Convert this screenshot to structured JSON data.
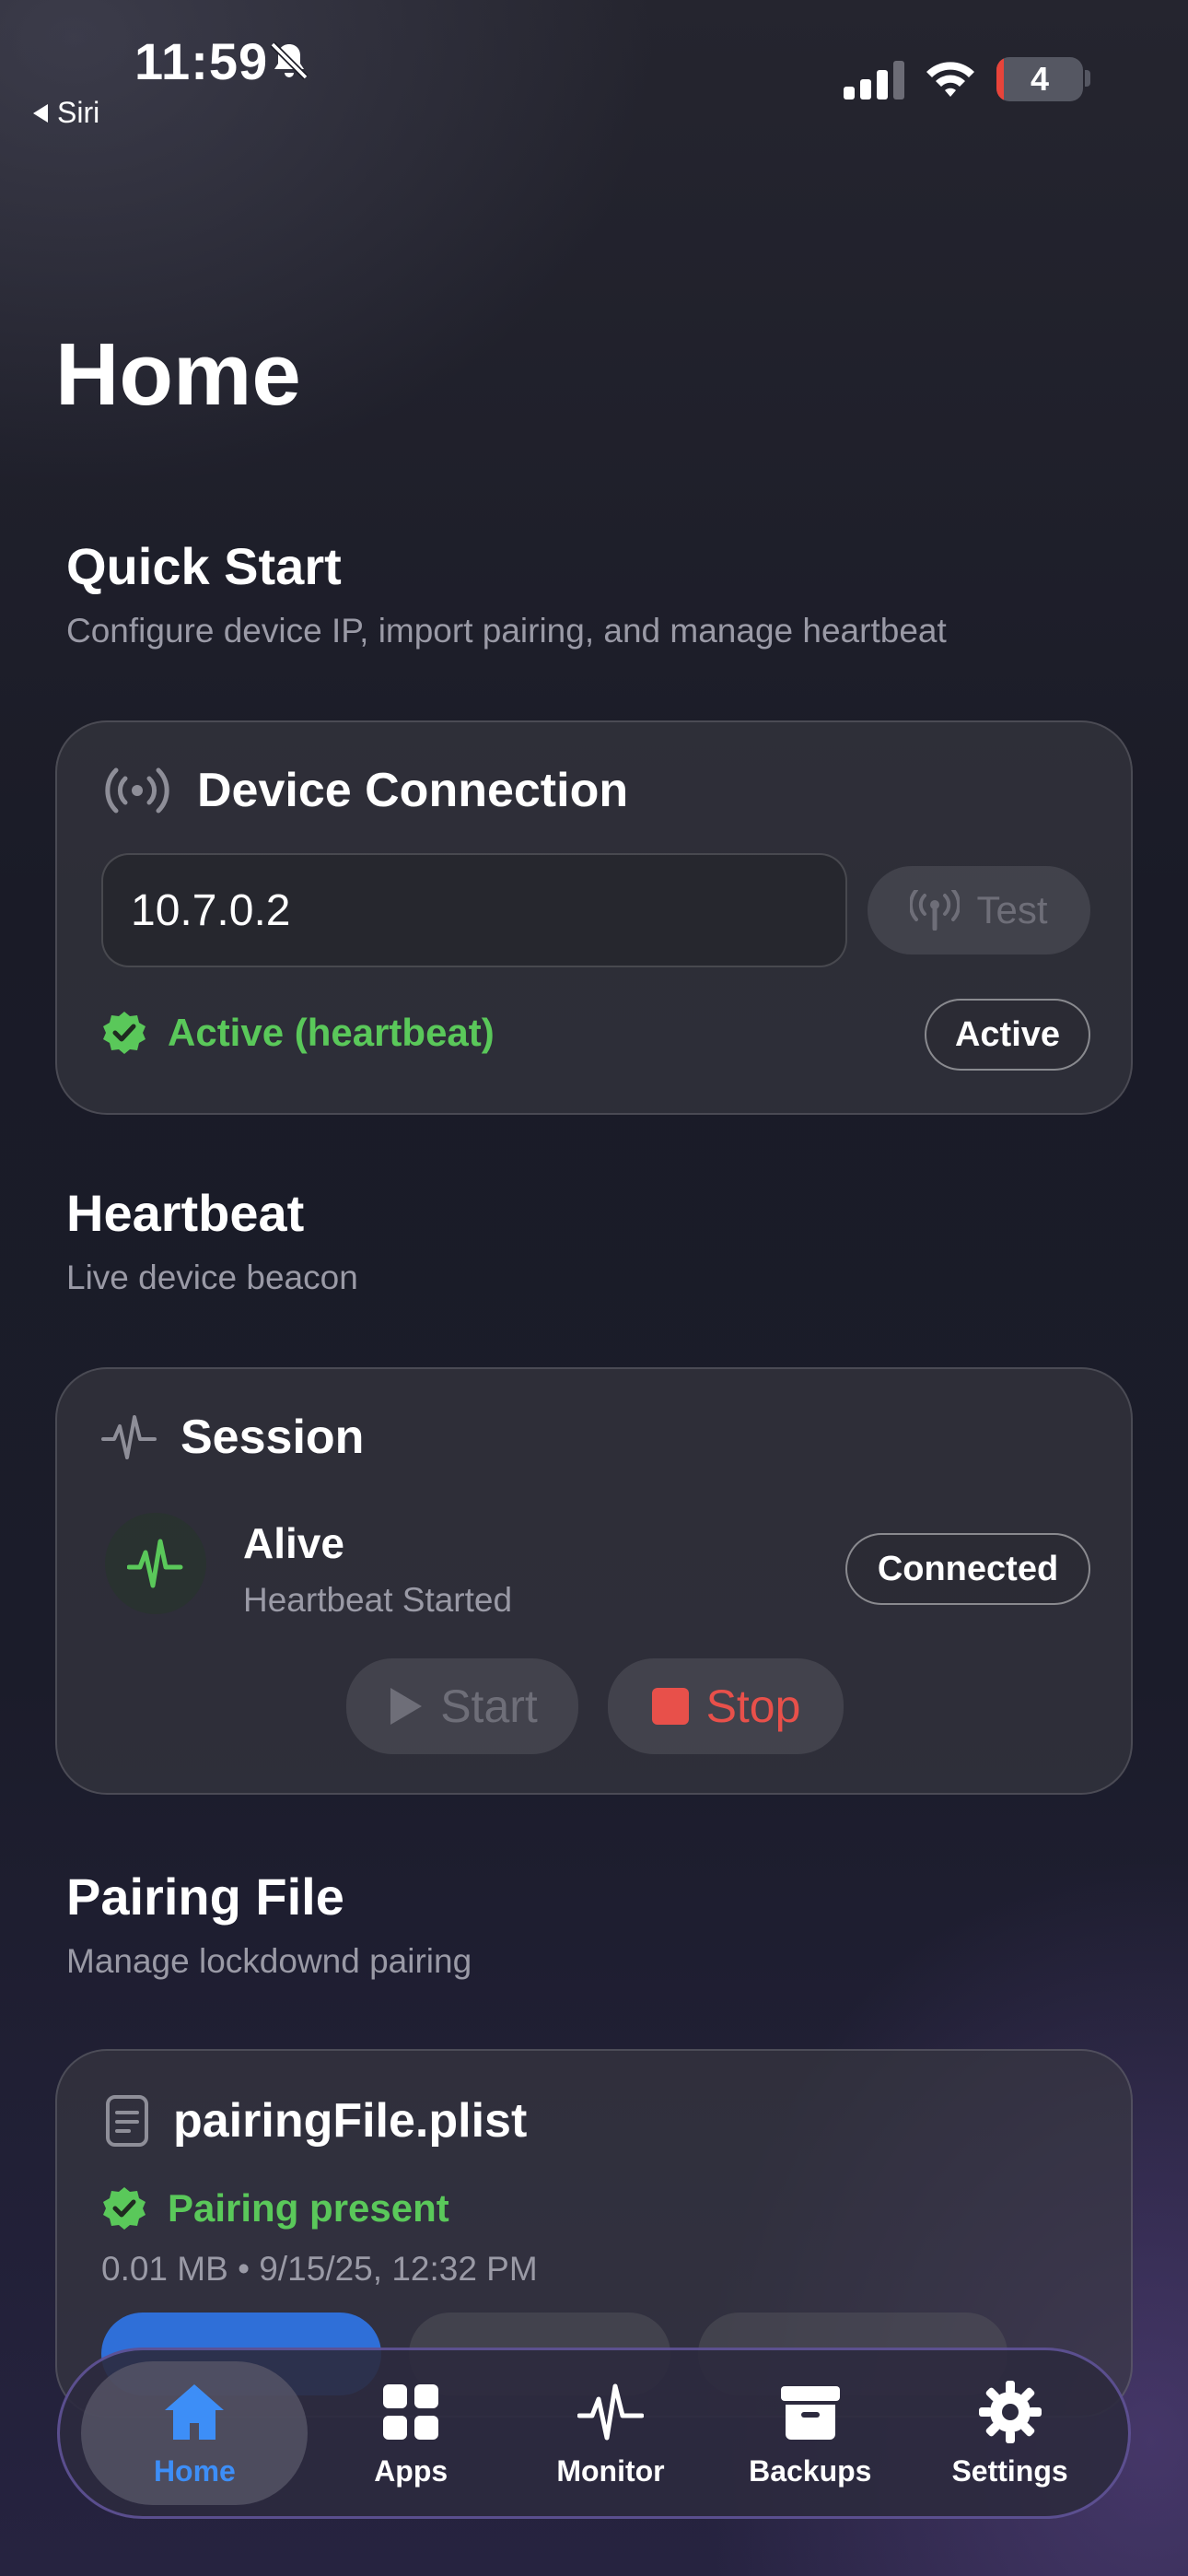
{
  "status_bar": {
    "time": "11:59",
    "back_label": "Siri",
    "battery": "4"
  },
  "page": {
    "title": "Home"
  },
  "quick_start": {
    "title": "Quick Start",
    "subtitle": "Configure device IP, import pairing, and manage heartbeat"
  },
  "device_connection": {
    "title": "Device Connection",
    "ip_value": "10.7.0.2",
    "test_label": "Test",
    "status_text": "Active (heartbeat)",
    "status_badge": "Active",
    "icon": "antenna-radiowaves-icon"
  },
  "heartbeat": {
    "title": "Heartbeat",
    "subtitle": "Live device beacon"
  },
  "session": {
    "title": "Session",
    "state": "Alive",
    "detail": "Heartbeat Started",
    "badge": "Connected",
    "start_label": "Start",
    "stop_label": "Stop",
    "accent_green": "#5ac85a",
    "stop_red": "#e8504a"
  },
  "pairing": {
    "title": "Pairing File",
    "subtitle": "Manage lockdownd pairing",
    "file_name": "pairingFile.plist",
    "status": "Pairing present",
    "meta": "0.01 MB • 9/15/25, 12:32 PM"
  },
  "tab_bar": {
    "items": [
      {
        "label": "Home",
        "icon": "house-icon",
        "active": true
      },
      {
        "label": "Apps",
        "icon": "grid-icon",
        "active": false
      },
      {
        "label": "Monitor",
        "icon": "waveform-icon",
        "active": false
      },
      {
        "label": "Backups",
        "icon": "archivebox-icon",
        "active": false
      },
      {
        "label": "Settings",
        "icon": "gear-icon",
        "active": false
      }
    ],
    "active_color": "#3d8ef7"
  }
}
